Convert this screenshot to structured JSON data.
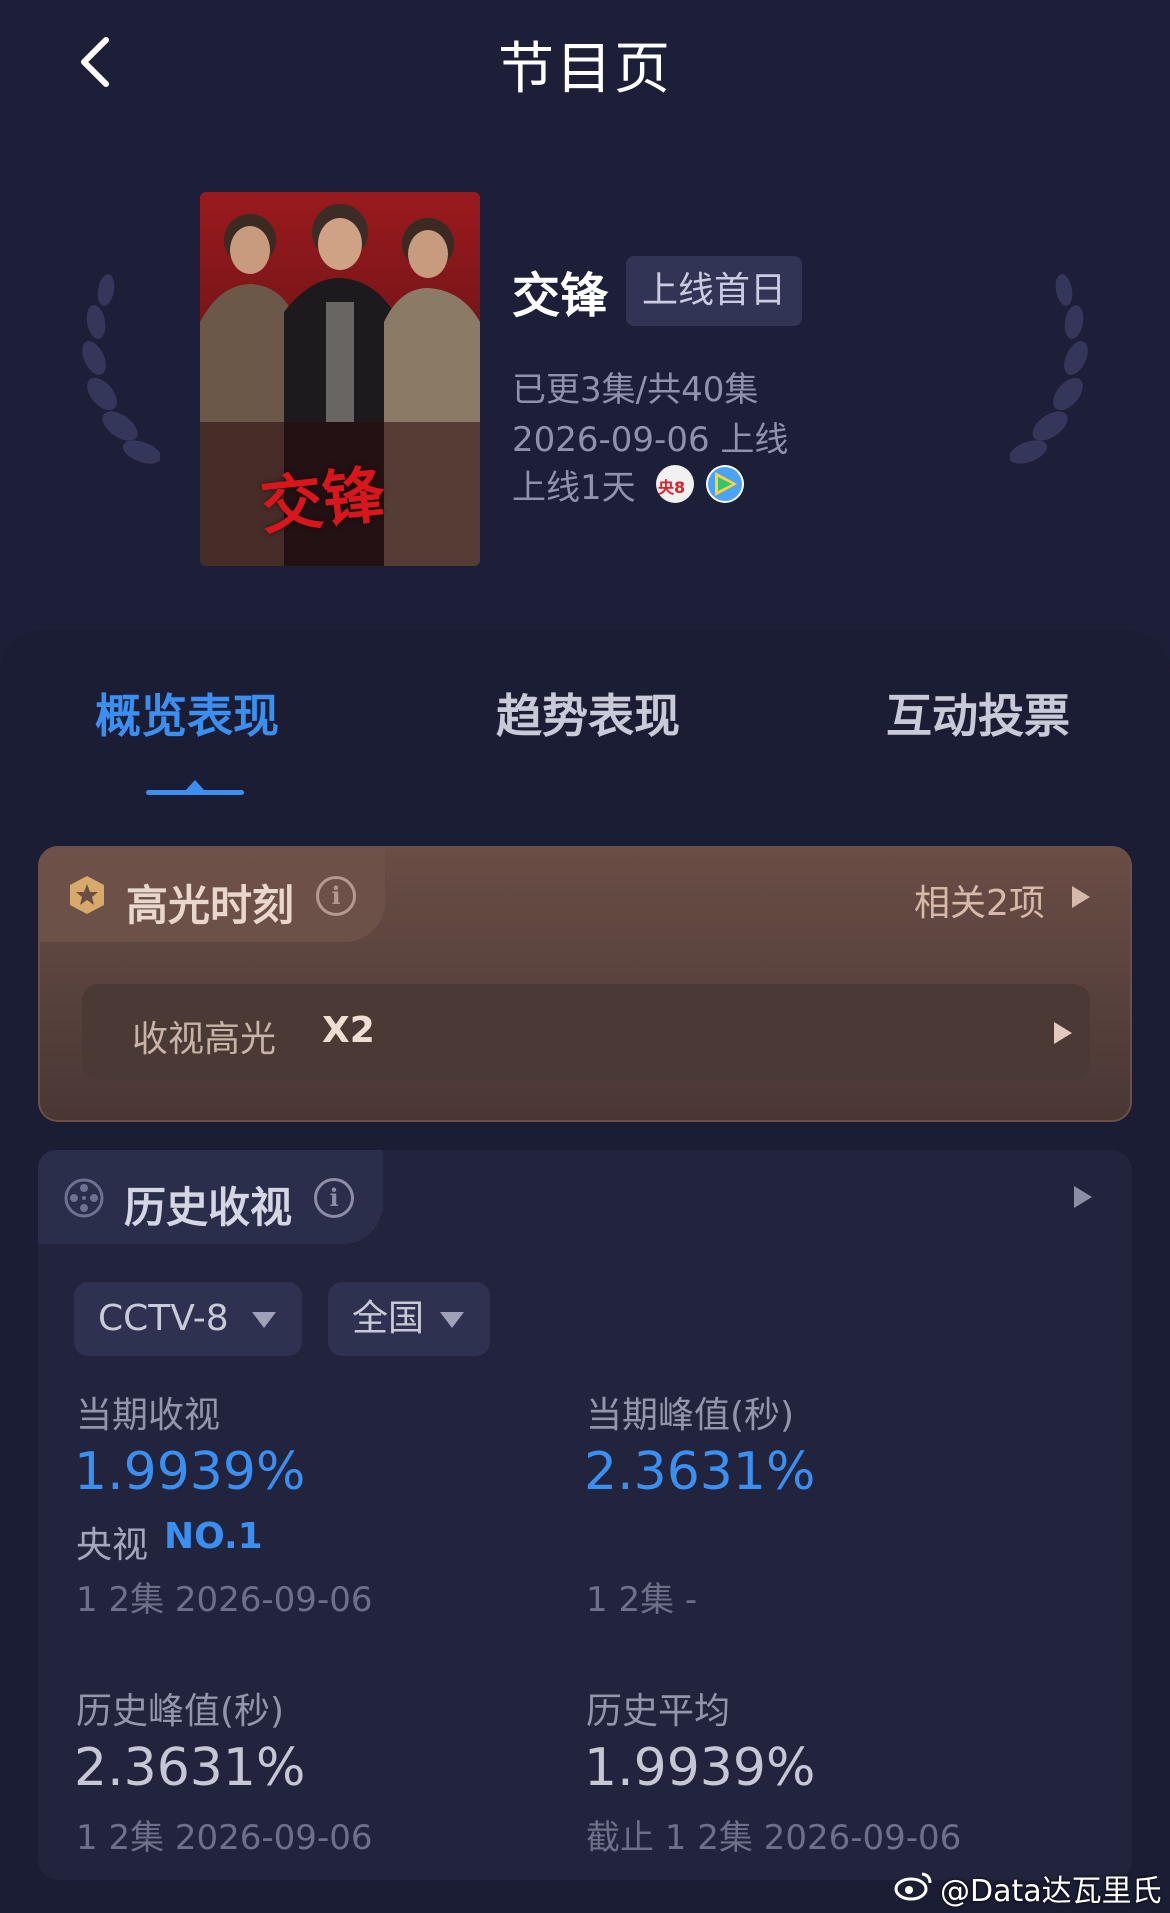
{
  "header": {
    "title": "节目页"
  },
  "show": {
    "poster_title": "交锋",
    "name": "交锋",
    "status_badge": "上线首日",
    "episodes": "已更3集/共40集",
    "release": "2026-09-06 上线",
    "days_online": "上线1天",
    "channel_badge": "央8",
    "channel_icons": [
      "cctv8-icon",
      "play-platform-icon"
    ]
  },
  "tabs": [
    {
      "label": "概览表现",
      "active": true
    },
    {
      "label": "趋势表现",
      "active": false
    },
    {
      "label": "互动投票",
      "active": false
    }
  ],
  "highlights": {
    "title": "高光时刻",
    "related": "相关2项",
    "item_label": "收视高光",
    "item_count": "X2"
  },
  "history": {
    "title": "历史收视",
    "channel": "CCTV-8",
    "region": "全国",
    "current_rating": {
      "label": "当期收视",
      "value": "1.9939%",
      "rank_label": "央视",
      "rank": "NO.1",
      "sub": "1 2集 2026-09-06"
    },
    "current_peak": {
      "label": "当期峰值(秒)",
      "value": "2.3631%",
      "sub": "1 2集 -"
    },
    "history_peak": {
      "label": "历史峰值(秒)",
      "value": "2.3631%",
      "sub": "1 2集 2026-09-06"
    },
    "history_avg": {
      "label": "历史平均",
      "value": "1.9939%",
      "sub": "截止 1 2集 2026-09-06"
    }
  },
  "watermark": "@Data达瓦里氏",
  "colors": {
    "accent": "#3a8ff0",
    "background": "#1d1f38",
    "highlight_card": "#5a433e"
  }
}
